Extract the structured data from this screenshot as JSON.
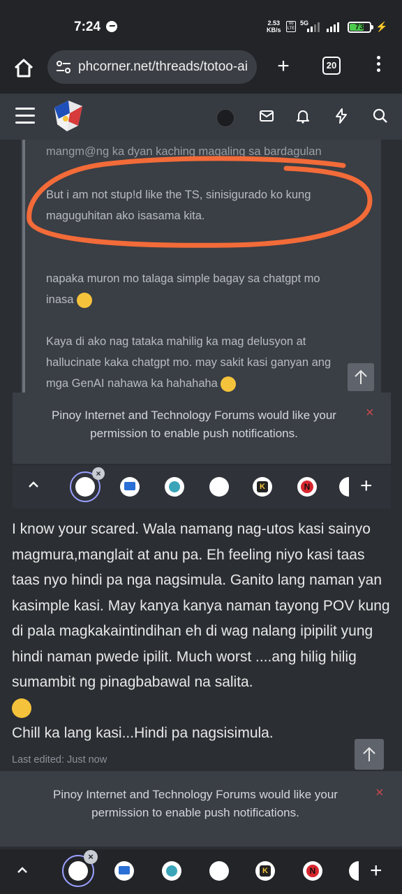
{
  "status_bar": {
    "time": "7:24",
    "speed_value": "2.53",
    "speed_unit": "KB/s",
    "network": "5G",
    "battery": "73",
    "battery_level": 0.73
  },
  "browser": {
    "url": "phcorner.net/threads/totoo-ai",
    "tab_count": "20"
  },
  "quote": {
    "line_cut": "mangm@ng ka dyan kaching magaling sa bardagulan",
    "line_1a": "But i am not stup!d like the TS, sinisigurado ko kung",
    "line_1b": "maguguhitan ako isasama kita.",
    "line_2a": "napaka muron mo talaga simple bagay sa chatgpt mo",
    "line_2b": "inasa",
    "line_3a": "Kaya di ako nag tataka mahilig ka mag delusyon at",
    "line_3b": "hallucinate kaka chatgpt mo. may sakit kasi ganyan ang",
    "line_3c": "mga GenAI nahawa ka hahahaha"
  },
  "push_notice": {
    "line1": "Pinoy Internet and Technology Forums would like your",
    "line2": "permission to enable push notifications.",
    "close": "×"
  },
  "post": {
    "p1": "I know your scared. Wala namang nag-utos kasi sainyo magmura,manglait at anu pa. Eh feeling niyo kasi taas taas nyo hindi pa nga nagsimula. Ganito lang naman yan kasimple kasi. May kanya kanya naman tayong POV kung di pala magkakaintindihan eh di wag nalang ipipilit yung hindi naman pwede ipilit. Much worst ....ang hilig hilig sumambit ng pinagbabawal na salita.",
    "p2": "Chill ka lang kasi...Hindi pa nagsisimula.",
    "edited": "Last edited: Just now"
  },
  "dock": {
    "plus": "+",
    "items": [
      "phcorner-tab",
      "video-tab",
      "zoom-tab",
      "blank-tab",
      "k-tab",
      "netflix-tab",
      "partial-tab"
    ]
  },
  "colors": {
    "accent_orange": "#f26b38",
    "background": "#2b2e33",
    "close_red": "#c94a4a"
  }
}
